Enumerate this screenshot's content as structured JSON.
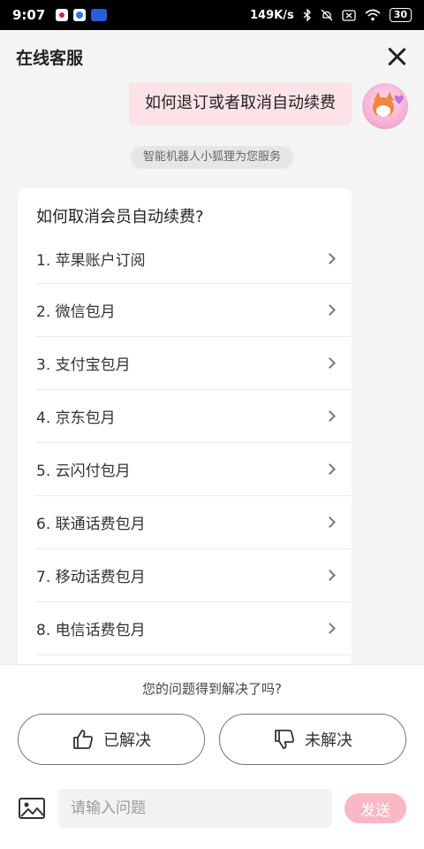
{
  "status_bar": {
    "time": "9:07",
    "network_speed": "149K/s",
    "battery": "30",
    "icons": [
      "notification-app-icon",
      "notification-app-icon-2",
      "notification-app-icon-3",
      "bluetooth-icon",
      "mute-icon",
      "sim-off-icon",
      "wifi-icon",
      "battery-icon"
    ]
  },
  "header": {
    "title": "在线客服",
    "close_icon": "close-icon"
  },
  "user_message": {
    "text": "如何退订或者取消自动续费",
    "avatar": "fox-avatar"
  },
  "system_note": "智能机器人小狐狸为您服务",
  "answer": {
    "title": "如何取消会员自动续费?",
    "items": [
      "1. 苹果账户订阅",
      "2. 微信包月",
      "3. 支付宝包月",
      "4. 京东包月",
      "5. 云闪付包月",
      "6. 联通话费包月",
      "7. 移动话费包月",
      "8. 电信话费包月"
    ]
  },
  "feedback": {
    "question": "您的问题得到解决了吗?",
    "resolved_label": "已解决",
    "unresolved_label": "未解决"
  },
  "input_bar": {
    "placeholder": "请输入问题",
    "send_label": "发送",
    "image_icon": "image-icon"
  },
  "colors": {
    "accent_pink": "#f9b8c5",
    "user_bubble": "#fde3e7"
  }
}
